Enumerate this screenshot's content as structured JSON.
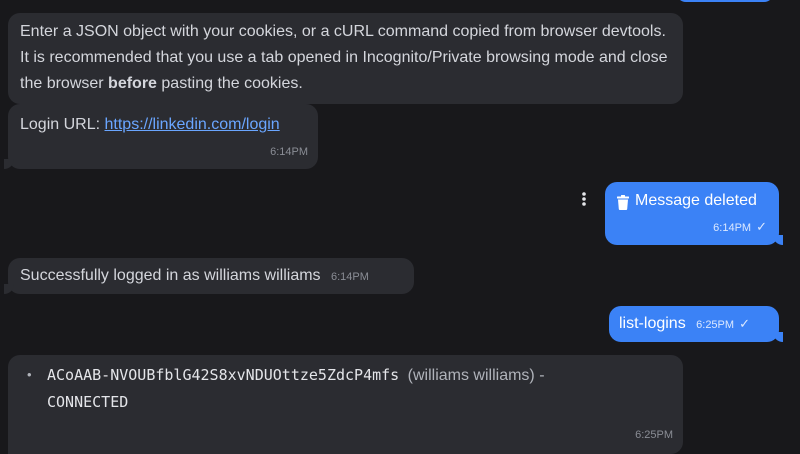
{
  "messages": {
    "instructions": {
      "text_before": "Enter a JSON object with your cookies, or a cURL command copied from browser devtools. It is recommended that you use a tab opened in Incognito/Private browsing mode and close the browser ",
      "bold": "before",
      "text_after": " pasting the cookies."
    },
    "login": {
      "label": "Login URL: ",
      "link": "https://linkedin.com/login",
      "time": "6:14PM"
    },
    "deleted": {
      "text": "Message deleted",
      "time": "6:14PM",
      "check": "✓"
    },
    "success": {
      "text": "Successfully logged in as williams williams",
      "time": "6:14PM"
    },
    "command": {
      "text": "list-logins",
      "time": "6:25PM",
      "check": "✓"
    },
    "logins": {
      "bullet": "•",
      "id": "ACoAAB-NVOUBfblG42S8xvNDUOttze5ZdcP4mfs",
      "name": "(williams williams) -",
      "status": "CONNECTED",
      "time": "6:25PM"
    }
  },
  "icons": {
    "menu": "more-vertical-icon",
    "trash": "trash-icon"
  },
  "colors": {
    "background": "#18181b",
    "incoming_bubble": "#2b2c31",
    "outgoing_bubble": "#3b82f6",
    "link": "#6aa6ff"
  }
}
